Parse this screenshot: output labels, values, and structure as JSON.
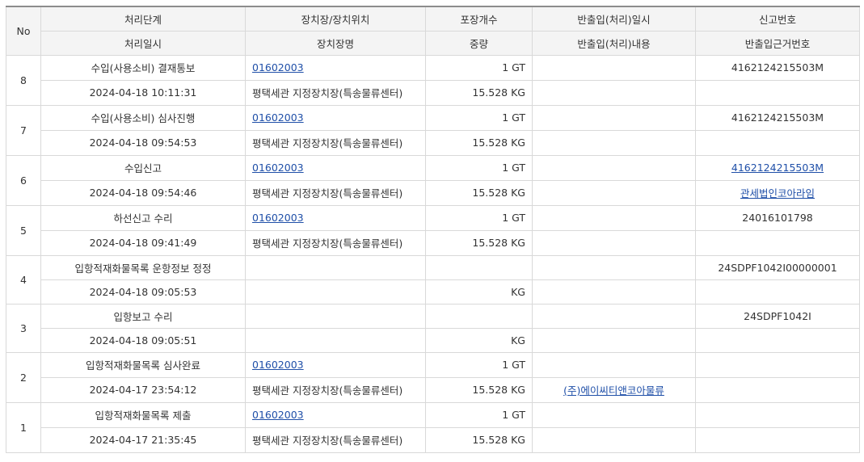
{
  "header": {
    "no": "No",
    "row1": [
      "처리단계",
      "장치장/장치위치",
      "포장개수",
      "반출입(처리)일시",
      "신고번호"
    ],
    "row2": [
      "처리일시",
      "장치장명",
      "중량",
      "반출입(처리)내용",
      "반출입근거번호"
    ]
  },
  "rows": [
    {
      "no": "8",
      "step": "수입(사용소비) 결재통보",
      "loc": "01602003",
      "pkg": "1 GT",
      "inout_time": "",
      "decl_no": "4162124215503M",
      "decl_link": false,
      "time": "2024-04-18 10:11:31",
      "loc_name": "평택세관 지정장치장(특송물류센터)",
      "weight": "15.528 KG",
      "inout_content": "",
      "basis_no": "",
      "basis_link": false
    },
    {
      "no": "7",
      "step": "수입(사용소비) 심사진행",
      "loc": "01602003",
      "pkg": "1 GT",
      "inout_time": "",
      "decl_no": "4162124215503M",
      "decl_link": false,
      "time": "2024-04-18 09:54:53",
      "loc_name": "평택세관 지정장치장(특송물류센터)",
      "weight": "15.528 KG",
      "inout_content": "",
      "basis_no": "",
      "basis_link": false
    },
    {
      "no": "6",
      "step": "수입신고",
      "loc": "01602003",
      "pkg": "1 GT",
      "inout_time": "",
      "decl_no": "4162124215503M",
      "decl_link": true,
      "time": "2024-04-18 09:54:46",
      "loc_name": "평택세관 지정장치장(특송물류센터)",
      "weight": "15.528 KG",
      "inout_content": "",
      "basis_no": "관세법인코아라임",
      "basis_link": true
    },
    {
      "no": "5",
      "step": "하선신고 수리",
      "loc": "01602003",
      "pkg": "1 GT",
      "inout_time": "",
      "decl_no": "24016101798",
      "decl_link": false,
      "time": "2024-04-18 09:41:49",
      "loc_name": "평택세관 지정장치장(특송물류센터)",
      "weight": "15.528 KG",
      "inout_content": "",
      "basis_no": "",
      "basis_link": false
    },
    {
      "no": "4",
      "step": "입항적재화물목록 운항정보 정정",
      "loc": "",
      "pkg": "",
      "inout_time": "",
      "decl_no": "24SDPF1042I00000001",
      "decl_link": false,
      "time": "2024-04-18 09:05:53",
      "loc_name": "",
      "weight": "KG",
      "inout_content": "",
      "basis_no": "",
      "basis_link": false,
      "small": true
    },
    {
      "no": "3",
      "step": "입항보고 수리",
      "loc": "",
      "pkg": "",
      "inout_time": "",
      "decl_no": "24SDPF1042I",
      "decl_link": false,
      "time": "2024-04-18 09:05:51",
      "loc_name": "",
      "weight": "KG",
      "inout_content": "",
      "basis_no": "",
      "basis_link": false,
      "small": true
    },
    {
      "no": "2",
      "step": "입항적재화물목록 심사완료",
      "loc": "01602003",
      "pkg": "1 GT",
      "inout_time": "",
      "decl_no": "",
      "decl_link": false,
      "time": "2024-04-17 23:54:12",
      "loc_name": "평택세관 지정장치장(특송물류센터)",
      "weight": "15.528 KG",
      "inout_content": "(주)에이씨티앤코아물류",
      "inout_link": true,
      "basis_no": "",
      "basis_link": false
    },
    {
      "no": "1",
      "step": "입항적재화물목록 제출",
      "loc": "01602003",
      "pkg": "1 GT",
      "inout_time": "",
      "decl_no": "",
      "decl_link": false,
      "time": "2024-04-17 21:35:45",
      "loc_name": "평택세관 지정장치장(특송물류센터)",
      "weight": "15.528 KG",
      "inout_content": "",
      "basis_no": "",
      "basis_link": false
    }
  ]
}
